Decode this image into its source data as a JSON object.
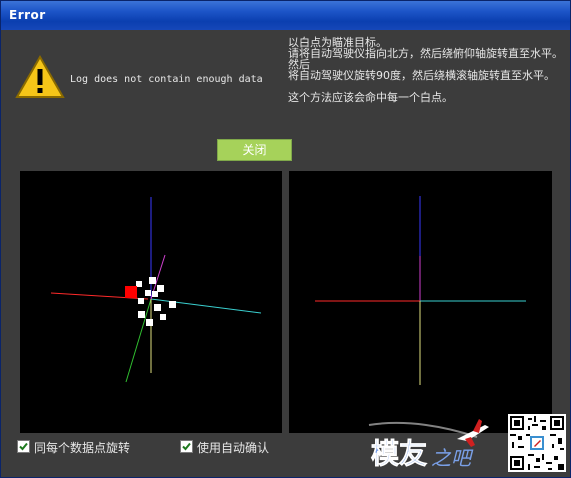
{
  "window": {
    "title": "Error"
  },
  "dialog": {
    "log_message": "Log does not contain enough data",
    "instructions": [
      "以白点为瞄准目标。",
      "请将自动驾驶仪指向北方，然后绕俯仰轴旋转直至水平。",
      "然后",
      "将自动驾驶仪旋转90度，然后绕横滚轴旋转直至水平。",
      "",
      "这个方法应该会命中每一个白点。"
    ],
    "close_label": "关闭"
  },
  "options": {
    "rotate_each_point_label": "同每个数据点旋转",
    "rotate_each_point_checked": true,
    "auto_accept_label": "使用自动确认",
    "auto_accept_checked": true
  },
  "watermark": {
    "text": "模友之吧"
  },
  "colors": {
    "axis_red": "#ff2a2a",
    "axis_blue": "#3a3aff",
    "axis_cyan": "#3ad0d0",
    "axis_magenta": "#d040d0",
    "axis_green": "#30c030",
    "axis_yellow": "#e0e080",
    "target_point": "#ffffff",
    "current_point": "#ff0000",
    "button_bg": "#a6d25a"
  }
}
